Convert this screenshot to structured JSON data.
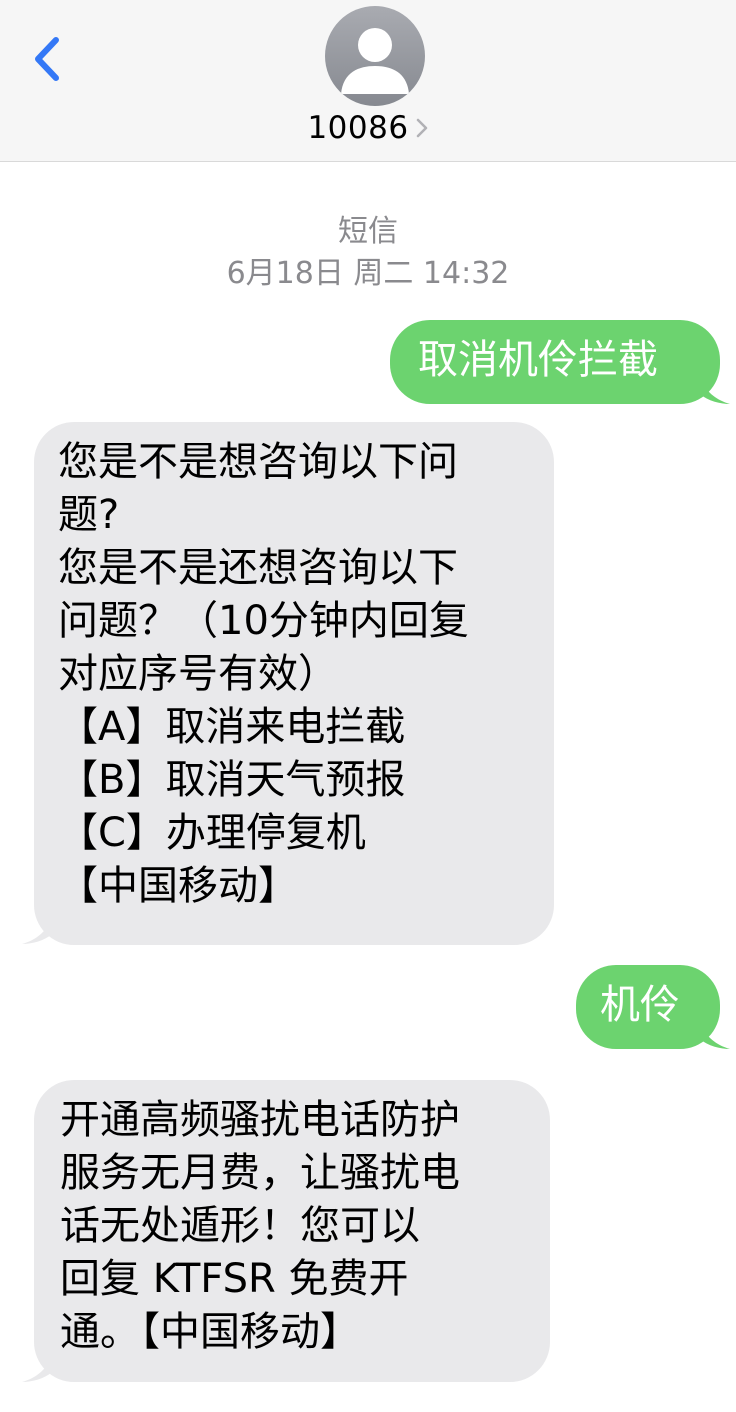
{
  "header": {
    "back_icon": "chevron-left-icon",
    "contact_name": "10086",
    "avatar_icon": "person-silhouette-icon",
    "accent_color": "#3478f6"
  },
  "thread": {
    "type_label": "短信",
    "timestamp": "6月18日 周二 14:32"
  },
  "messages": [
    {
      "direction": "outgoing",
      "text": "取消机伶拦截"
    },
    {
      "direction": "incoming",
      "text": "您是不是想咨询以下问\n题?\n您是不是还想咨询以下\n问题？（10分钟内回复\n对应序号有效）\n【A】取消来电拦截\n【B】取消天气预报\n【C】办理停复机\n【中国移动】"
    },
    {
      "direction": "outgoing",
      "text": "机伶"
    },
    {
      "direction": "incoming",
      "text": "开通高频骚扰电话防护\n服务无月费，让骚扰电\n话无处遁形！您可以\n回复 KTFSR 免费开\n通。【中国移动】"
    }
  ],
  "colors": {
    "outgoing_bubble": "#6cd36f",
    "incoming_bubble": "#e9e9eb",
    "meta_text": "#8a8a8e"
  }
}
